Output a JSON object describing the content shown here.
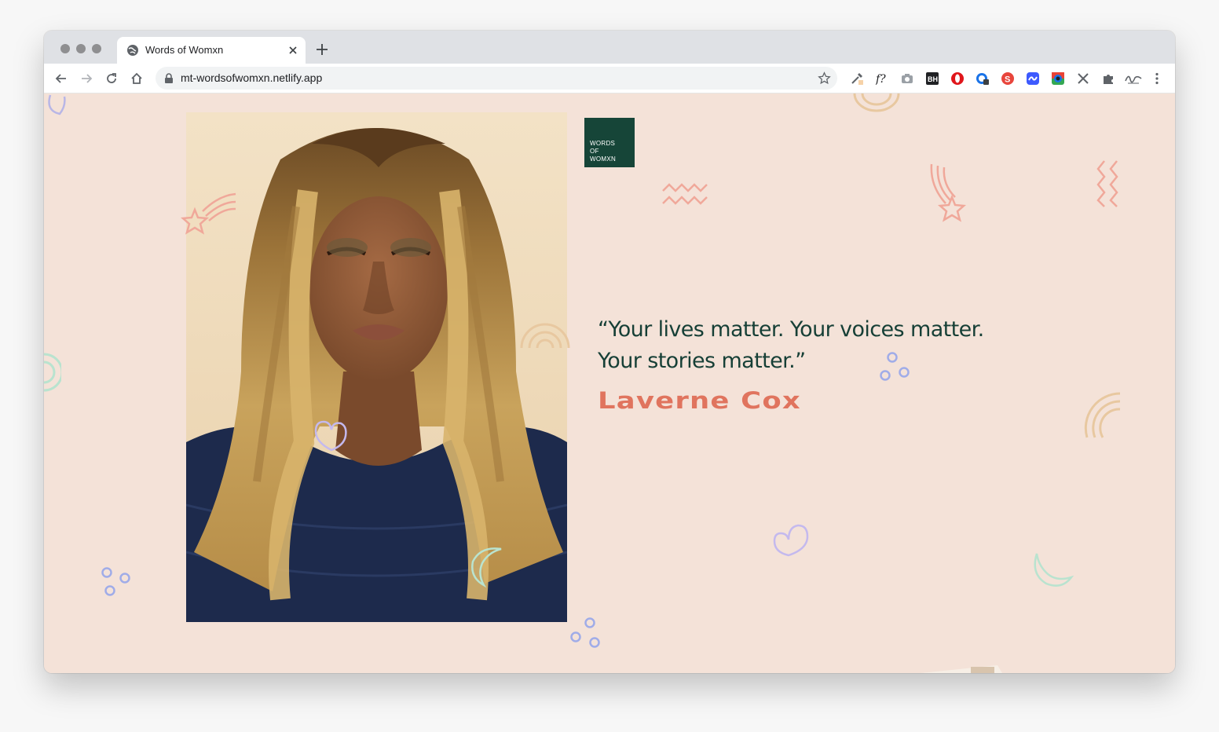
{
  "browser": {
    "tab": {
      "title": "Words of Womxn"
    },
    "address_bar": {
      "url": "mt-wordsofwomxn.netlify.app"
    },
    "extensions": [
      "eyedropper-icon",
      "font-finder-icon",
      "camera-icon",
      "bh-extension-icon",
      "opera-icon",
      "privacy-icon",
      "s-extension-icon",
      "blue-extension-icon",
      "color-wheel-icon",
      "tools-icon",
      "puzzle-icon",
      "signature-extension-icon"
    ]
  },
  "page": {
    "logo": {
      "text": "WORDS\nOF\nWOMXN"
    },
    "quote": {
      "line1": "“Your lives matter. Your voices matter.",
      "line2": "Your stories matter.”"
    },
    "author": "Laverne Cox",
    "colors": {
      "background": "#f4e2d8",
      "logo_bg": "#164538",
      "quote_text": "#163f36",
      "author_text": "#e0745e"
    }
  }
}
